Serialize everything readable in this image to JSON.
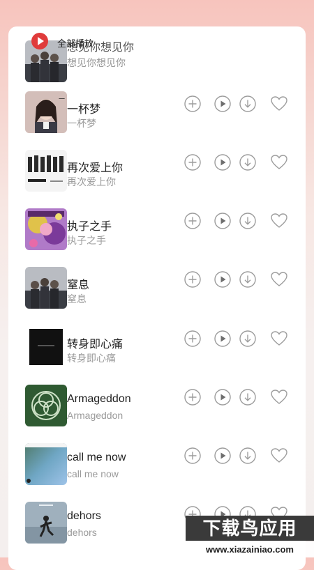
{
  "header": {
    "play_all_label": "全部播放"
  },
  "songs": [
    {
      "title": "想见你想见你",
      "subtitle": "想见你想见你",
      "cover_icon": "group-photo-cover"
    },
    {
      "title": "一杯梦",
      "subtitle": "一杯梦",
      "cover_icon": "portrait-cover"
    },
    {
      "title": "再次爱上你",
      "subtitle": "再次爱上你",
      "cover_icon": "group-lineup-cover"
    },
    {
      "title": "执子之手",
      "subtitle": "执子之手",
      "cover_icon": "colorful-art-cover"
    },
    {
      "title": "窒息",
      "subtitle": "窒息",
      "cover_icon": "group-photo-cover"
    },
    {
      "title": "转身即心痛",
      "subtitle": "转身即心痛",
      "cover_icon": "dark-text-cover"
    },
    {
      "title": "Armageddon",
      "subtitle": "Armageddon",
      "cover_icon": "green-emblem-cover"
    },
    {
      "title": "call me now",
      "subtitle": "call me now",
      "cover_icon": "gradient-cover"
    },
    {
      "title": "dehors",
      "subtitle": "dehors",
      "cover_icon": "figure-cover"
    }
  ],
  "row_actions": [
    "add-to-playlist-icon",
    "play-circle-icon",
    "download-icon",
    "heart-icon"
  ],
  "watermark": {
    "main": "下载鸟应用",
    "url": "www.xiazainiao.com"
  },
  "colors": {
    "accent": "#e03b3b",
    "icon_gray": "#9c9c9c"
  }
}
